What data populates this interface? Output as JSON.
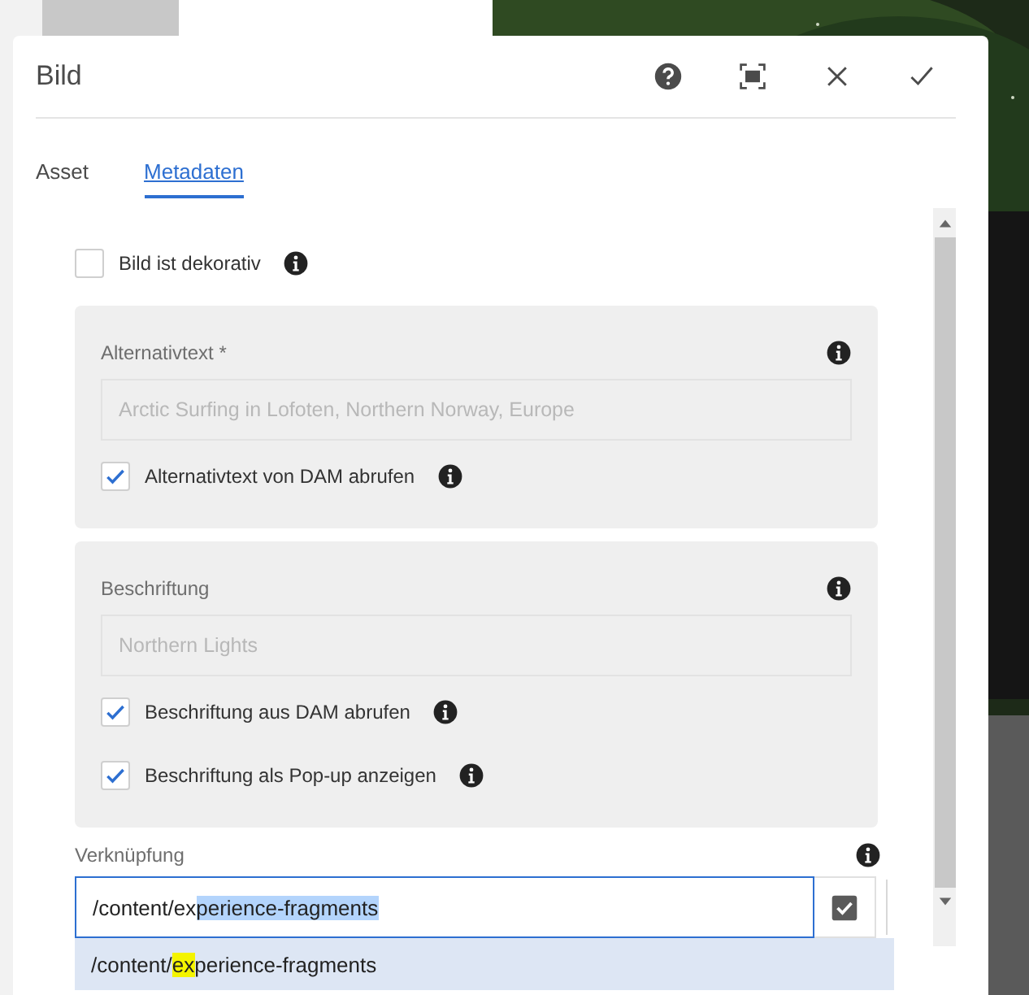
{
  "dialog": {
    "title": "Bild"
  },
  "tabs": [
    {
      "label": "Asset",
      "selected": false
    },
    {
      "label": "Metadaten",
      "selected": true
    }
  ],
  "decorative": {
    "label": "Bild ist dekorativ",
    "checked": false
  },
  "panels": [
    {
      "label": "Alternativtext *",
      "placeholder": "Arctic Surfing in Lofoten, Northern Norway, Europe",
      "checkboxes": [
        {
          "label": "Alternativtext von DAM abrufen",
          "checked": true
        }
      ]
    },
    {
      "label": "Beschriftung",
      "placeholder": "Northern Lights",
      "checkboxes": [
        {
          "label": "Beschriftung aus DAM abrufen",
          "checked": true
        },
        {
          "label": "Beschriftung als Pop-up anzeigen",
          "checked": true
        }
      ]
    }
  ],
  "link": {
    "label": "Verknüpfung",
    "value_parts": [
      {
        "text": "/content/ex",
        "selected": false
      },
      {
        "text": "perience-fragments",
        "selected": true
      }
    ],
    "suggestions": [
      {
        "parts": [
          {
            "text": "/content/",
            "highlighted": false
          },
          {
            "text": "ex",
            "highlighted": true
          },
          {
            "text": "perience-fragments",
            "highlighted": false
          }
        ]
      }
    ]
  }
}
